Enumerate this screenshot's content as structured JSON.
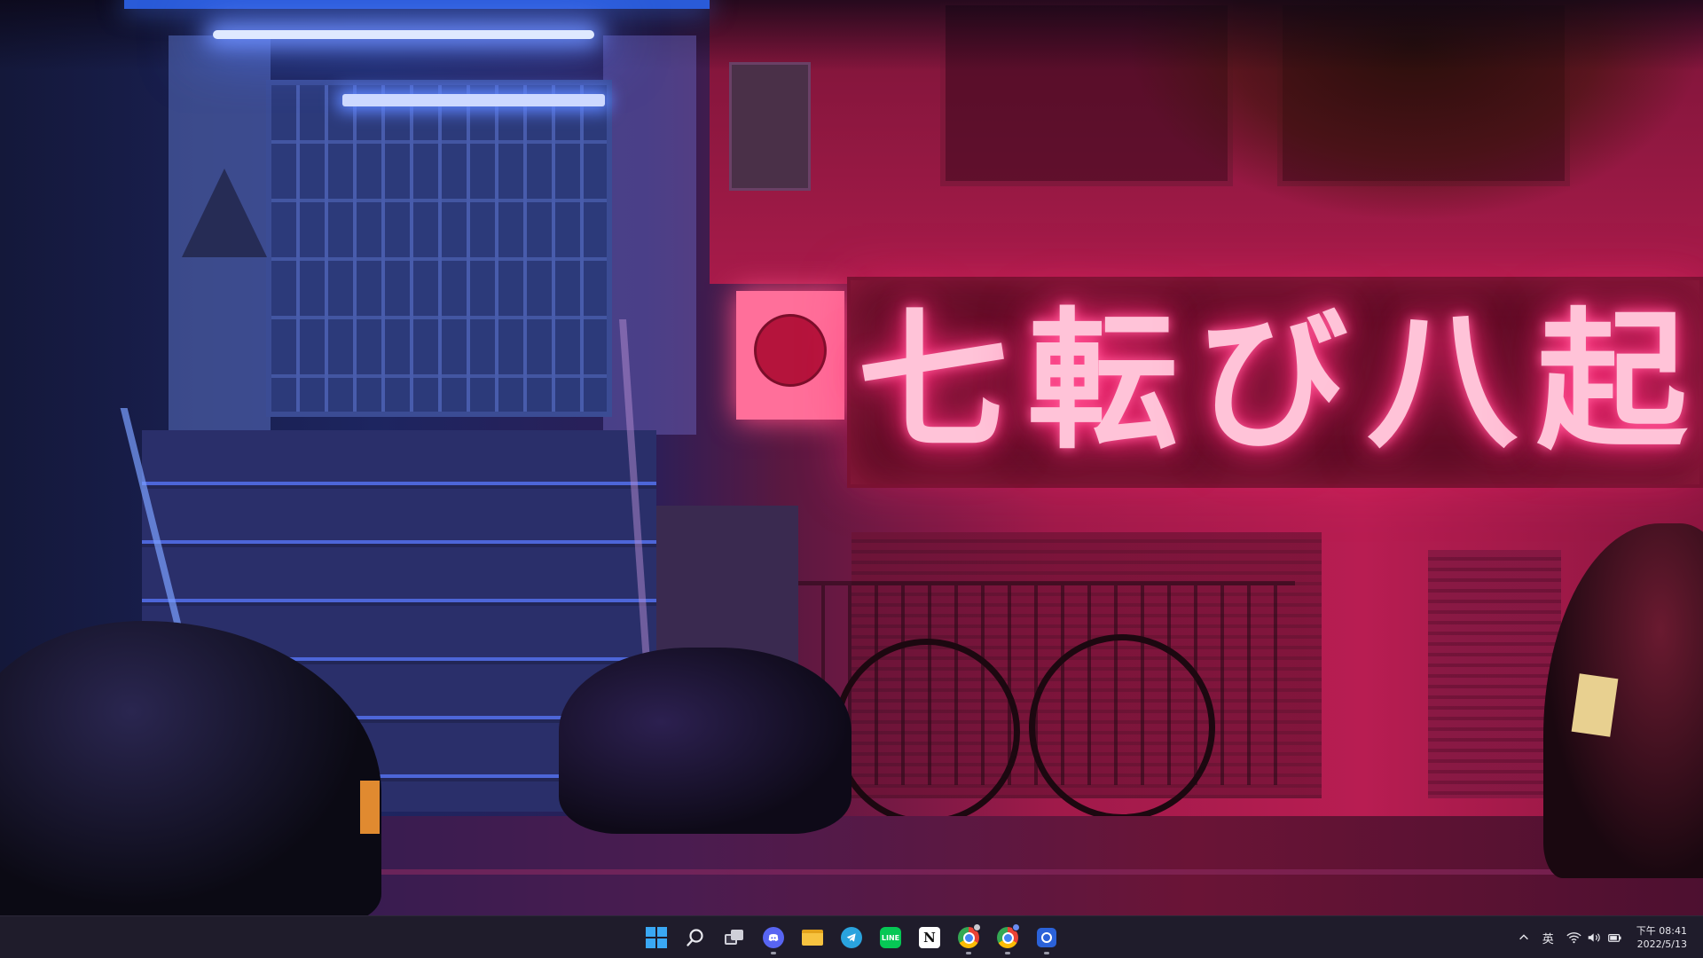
{
  "wallpaper": {
    "sign_characters": [
      "七",
      "転",
      "び",
      "八",
      "起"
    ],
    "colors": {
      "neon_pink": "#ff2a78",
      "neon_blue": "#4a7bff"
    }
  },
  "taskbar": {
    "background": "#1f1c2b",
    "pinned": [
      {
        "name": "start-button",
        "icon": "windows-icon",
        "running": false,
        "active": false
      },
      {
        "name": "search-button",
        "icon": "search-icon",
        "running": false,
        "active": false
      },
      {
        "name": "task-view-button",
        "icon": "task-view-icon",
        "running": false,
        "active": false
      },
      {
        "name": "discord-button",
        "icon": "discord-icon",
        "running": true,
        "active": false
      },
      {
        "name": "file-explorer-button",
        "icon": "folder-icon",
        "running": false,
        "active": false
      },
      {
        "name": "telegram-button",
        "icon": "telegram-icon",
        "running": false,
        "active": false
      },
      {
        "name": "line-button",
        "icon": "line-icon",
        "running": false,
        "active": false,
        "label": "LINE"
      },
      {
        "name": "notion-button",
        "icon": "notion-icon",
        "running": false,
        "active": false,
        "label": "N"
      },
      {
        "name": "chrome-button-1",
        "icon": "chrome-icon",
        "running": true,
        "active": false
      },
      {
        "name": "chrome-button-2",
        "icon": "chrome-icon",
        "running": true,
        "active": false
      },
      {
        "name": "snipping-tool-button",
        "icon": "snipping-tool-icon",
        "running": true,
        "active": false
      }
    ],
    "tray": {
      "chevron": "^",
      "ime": "英",
      "clock_time": "下午 08:41",
      "clock_date": "2022/5/13"
    }
  }
}
